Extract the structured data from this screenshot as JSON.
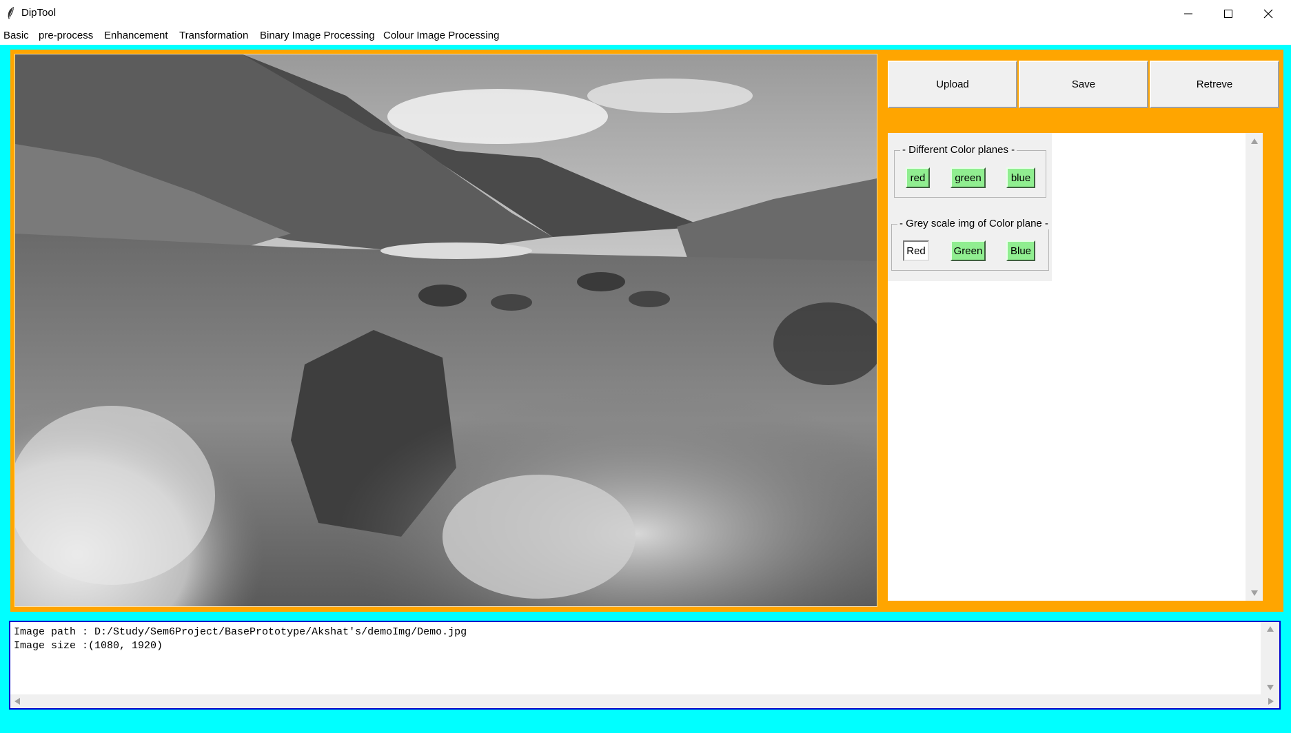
{
  "window": {
    "title": "DipTool",
    "icons": [
      "feather-app-icon",
      "minimize-icon",
      "maximize-icon",
      "close-icon"
    ]
  },
  "menu": {
    "items": [
      "Basic",
      "pre-process",
      "Enhancement",
      "Transformation",
      "Binary Image Processing",
      "Colour Image Processing"
    ]
  },
  "toolbar": {
    "upload_label": "Upload",
    "save_label": "Save",
    "retrieve_label": "Retreve"
  },
  "color_planes": {
    "legend": "Different Color planes",
    "buttons": [
      "red",
      "green",
      "blue"
    ]
  },
  "grey_planes": {
    "legend": "Grey scale img of Color plane",
    "buttons": [
      "Red",
      "Green",
      "Blue"
    ]
  },
  "log": {
    "line1": "Image path : D:/Study/Sem6Project/BasePrototype/Akshat's/demoImg/Demo.jpg",
    "line2": "Image size :(1080, 1920)"
  },
  "colors": {
    "background": "#00ffff",
    "panel_frame": "#ffa500",
    "plane_button": "#90ee90",
    "log_border": "#0000cc"
  }
}
